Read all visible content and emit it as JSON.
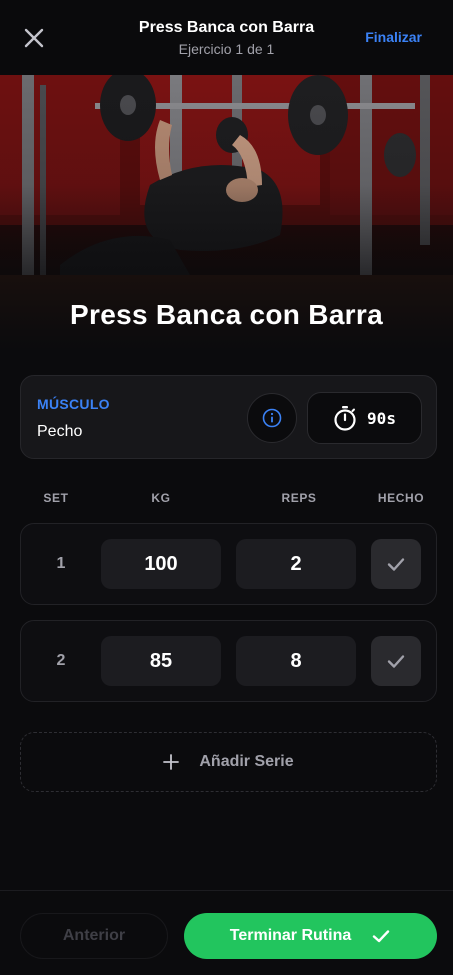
{
  "header": {
    "title": "Press Banca con Barra",
    "subtitle": "Ejercicio 1 de 1",
    "finish_link": "Finalizar",
    "close_icon": "close-icon"
  },
  "hero": {
    "title": "Press Banca con Barra",
    "image": "bench-press-photo"
  },
  "muscle": {
    "label": "MÚSCULO",
    "value": "Pecho",
    "info_icon": "info-icon",
    "timer_icon": "stopwatch-icon",
    "timer_value": "90s"
  },
  "table": {
    "headers": {
      "set": "SET",
      "kg": "KG",
      "reps": "REPS",
      "done": "HECHO"
    },
    "rows": [
      {
        "set": "1",
        "kg": "100",
        "reps": "2",
        "done": false
      },
      {
        "set": "2",
        "kg": "85",
        "reps": "8",
        "done": false
      }
    ]
  },
  "add_set": {
    "label": "Añadir Serie",
    "icon": "plus-icon"
  },
  "footer": {
    "prev_label": "Anterior",
    "finish_label": "Terminar Rutina",
    "finish_icon": "check-icon"
  },
  "colors": {
    "accent_blue": "#3b82f6",
    "success_green": "#22c55e",
    "background": "#0b0b0d"
  }
}
